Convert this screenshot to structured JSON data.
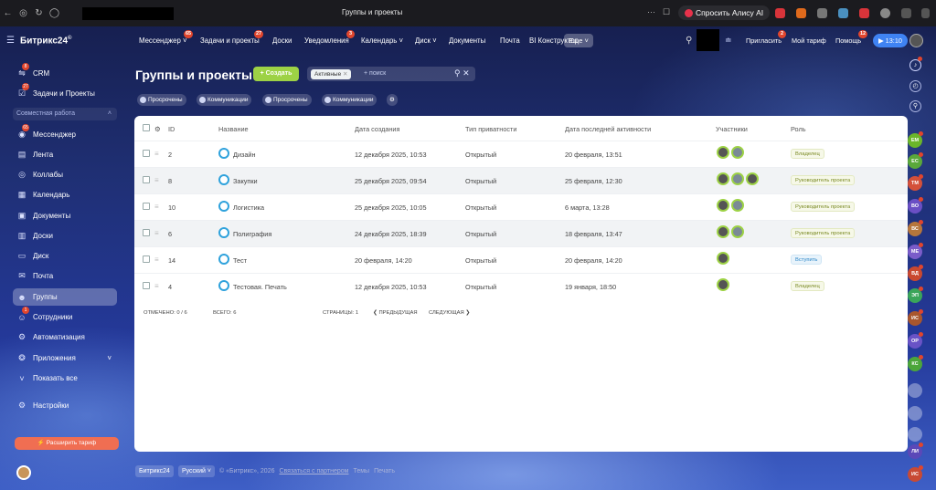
{
  "browser": {
    "window_title": "Группы и проекты",
    "ask_alice": "Спросить Алису AI",
    "dots": "···"
  },
  "header": {
    "logo": "Битрикс24",
    "logo_mark": "©",
    "nav": [
      {
        "label": "Мессенджер ˅",
        "badge": "65"
      },
      {
        "label": "Задачи и проекты",
        "badge": "27"
      },
      {
        "label": "Доски",
        "badge": ""
      },
      {
        "label": "Уведомления",
        "badge": "3"
      },
      {
        "label": "Календарь ˅",
        "badge": ""
      },
      {
        "label": "Диск ˅",
        "badge": ""
      },
      {
        "label": "Документы",
        "badge": ""
      },
      {
        "label": "Почта",
        "badge": ""
      },
      {
        "label": "BI Конструктор",
        "badge": ""
      }
    ],
    "more": "Еще ˅",
    "invite": "Пригласить",
    "invite_badge": "2",
    "my_plan": "Мой тариф",
    "help": "Помощь",
    "help_badge": "12",
    "time": "▶ 13:10"
  },
  "sidebar": {
    "items": [
      {
        "label": "CRM",
        "badge": "8"
      },
      {
        "label": "Задачи и Проекты",
        "badge": "27"
      },
      {
        "label": "Мессенджер",
        "badge": "65"
      },
      {
        "label": "Лента",
        "badge": ""
      },
      {
        "label": "Коллабы",
        "badge": ""
      },
      {
        "label": "Календарь",
        "badge": ""
      },
      {
        "label": "Документы",
        "badge": ""
      },
      {
        "label": "Доски",
        "badge": ""
      },
      {
        "label": "Диск",
        "badge": ""
      },
      {
        "label": "Почта",
        "badge": ""
      },
      {
        "label": "Группы",
        "badge": ""
      },
      {
        "label": "Сотрудники",
        "badge": "1"
      },
      {
        "label": "Автоматизация",
        "badge": ""
      },
      {
        "label": "Приложения",
        "badge": ""
      },
      {
        "label": "Показать все",
        "badge": ""
      },
      {
        "label": "Настройки",
        "badge": ""
      }
    ],
    "section": "Совместная работа",
    "upgrade": "Расширить тариф"
  },
  "page": {
    "title": "Группы и проекты",
    "create": "+ Создать",
    "filter_tag": "Активные",
    "filter_tag_close": "✕",
    "search_placeholder": "+ поиск",
    "chips": [
      "Просрочены",
      "Коммуникации",
      "Просрочены",
      "Коммуникации"
    ]
  },
  "table": {
    "columns": [
      "ID",
      "Название",
      "Дата создания",
      "Тип приватности",
      "Дата последней активности",
      "Участники",
      "Роль"
    ],
    "rows": [
      {
        "id": "2",
        "name": "Дизайн",
        "created": "12 декабря 2025, 10:53",
        "privacy": "Открытый",
        "activity": "20 февраля, 13:51",
        "role": "Владелец",
        "role_type": "owner",
        "members": 2
      },
      {
        "id": "8",
        "name": "Закупки",
        "created": "25 декабря 2025, 09:54",
        "privacy": "Открытый",
        "activity": "25 февраля, 12:30",
        "role": "Руководитель проекта",
        "role_type": "owner",
        "members": 3
      },
      {
        "id": "10",
        "name": "Логистика",
        "created": "25 декабря 2025, 10:05",
        "privacy": "Открытый",
        "activity": "6 марта, 13:28",
        "role": "Руководитель проекта",
        "role_type": "owner",
        "members": 2
      },
      {
        "id": "6",
        "name": "Полиграфия",
        "created": "24 декабря 2025, 18:39",
        "privacy": "Открытый",
        "activity": "18 февраля, 13:47",
        "role": "Руководитель проекта",
        "role_type": "owner",
        "members": 2
      },
      {
        "id": "14",
        "name": "Тест",
        "created": "20 февраля, 14:20",
        "privacy": "Открытый",
        "activity": "20 февраля, 14:20",
        "role": "Вступить",
        "role_type": "join",
        "members": 1
      },
      {
        "id": "4",
        "name": "Тестовая. Печать",
        "created": "12 декабря 2025, 10:53",
        "privacy": "Открытый",
        "activity": "19 января, 18:50",
        "role": "Владелец",
        "role_type": "owner",
        "members": 1
      }
    ],
    "marked": "ОТМЕЧЕНО: 0 / 6",
    "total": "ВСЕГО: 6",
    "pages": "СТРАНИЦЫ: 1",
    "prev": "❮ ПРЕДЫДУЩАЯ",
    "next": "СЛЕДУЮЩАЯ ❯"
  },
  "right_bar": {
    "avatars": [
      {
        "initials": "ЕМ",
        "color": "#6bb52a"
      },
      {
        "initials": "ЕС",
        "color": "#5aa83a"
      },
      {
        "initials": "ТМ",
        "color": "#d4503a"
      },
      {
        "initials": "ВО",
        "color": "#6a4fc4"
      },
      {
        "initials": "ВС",
        "color": "#b6763c"
      },
      {
        "initials": "МЕ",
        "color": "#7a5cc9"
      },
      {
        "initials": "ВД",
        "color": "#c9482f"
      },
      {
        "initials": "ЭП",
        "color": "#3aa55a"
      },
      {
        "initials": "ИС",
        "color": "#a8562d"
      },
      {
        "initials": "ОР",
        "color": "#6953c6"
      },
      {
        "initials": "КС",
        "color": "#4ca63a"
      },
      {
        "initials": "ЛИ",
        "color": "#5b48b8"
      },
      {
        "initials": "ИС",
        "color": "#c84a34"
      }
    ]
  },
  "footer": {
    "logo": "Битрикс24",
    "lang": "Русский ˅",
    "copyright": "© «Битрикс», 2026",
    "partner": "Связаться с партнером",
    "themes": "Темы",
    "print": "Печать"
  }
}
